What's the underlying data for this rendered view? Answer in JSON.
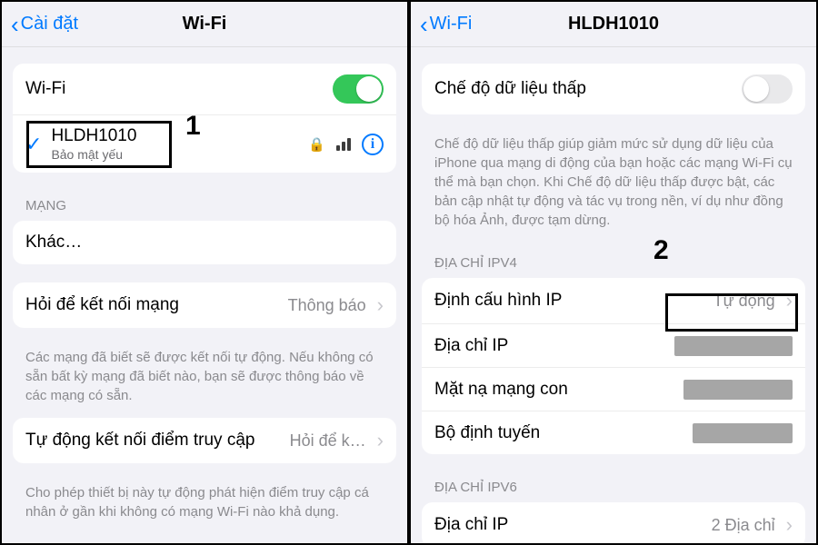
{
  "left": {
    "back": "Cài đặt",
    "title": "Wi-Fi",
    "wifi_label": "Wi-Fi",
    "connected": {
      "name": "HLDH1010",
      "security": "Bảo mật yếu"
    },
    "networks_header": "MẠNG",
    "other": "Khác…",
    "ask_join": {
      "label": "Hỏi để kết nối mạng",
      "value": "Thông báo"
    },
    "ask_join_footer": "Các mạng đã biết sẽ được kết nối tự động. Nếu không có sẵn bất kỳ mạng đã biết nào, bạn sẽ được thông báo về các mạng có sẵn.",
    "auto_hotspot": {
      "label": "Tự động kết nối điểm truy cập",
      "value": "Hỏi để k…"
    },
    "auto_hotspot_footer": "Cho phép thiết bị này tự động phát hiện điểm truy cập cá nhân ở gần khi không có mạng Wi-Fi nào khả dụng.",
    "annotation1": "1"
  },
  "right": {
    "back": "Wi-Fi",
    "title": "HLDH1010",
    "low_data": "Chế độ dữ liệu thấp",
    "low_data_footer": "Chế độ dữ liệu thấp giúp giảm mức sử dụng dữ liệu của iPhone qua mạng di động của bạn hoặc các mạng Wi-Fi cụ thể mà bạn chọn. Khi Chế độ dữ liệu thấp được bật, các bản cập nhật tự động và tác vụ trong nền, ví dụ như đồng bộ hóa Ảnh, được tạm dừng.",
    "ipv4_header": "ĐỊA CHỈ IPV4",
    "ipv4": {
      "configure": {
        "label": "Định cấu hình IP",
        "value": "Tự động"
      },
      "ip": {
        "label": "Địa chỉ IP"
      },
      "mask": {
        "label": "Mặt nạ mạng con"
      },
      "router": {
        "label": "Bộ định tuyến"
      }
    },
    "ipv6_header": "ĐỊA CHỈ IPV6",
    "ipv6_ip": {
      "label": "Địa chỉ IP",
      "value": "2 Địa chỉ"
    },
    "annotation2": "2"
  }
}
